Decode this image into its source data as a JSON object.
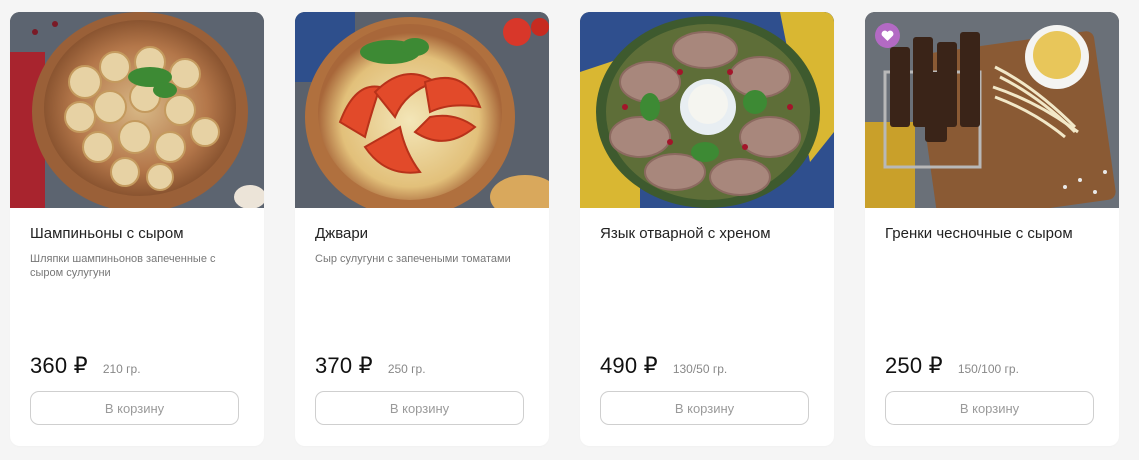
{
  "products": [
    {
      "title": "Шампиньоны с сыром",
      "description": "Шляпки шампиньонов запеченные с сыром сулугуни",
      "price": "360 ₽",
      "weight": "210 гр.",
      "cart_label": "В корзину",
      "image": "baked-mushrooms-clay-pot"
    },
    {
      "title": "Джвари",
      "description": "Сыр сулугуни с запечеными томатами",
      "price": "370 ₽",
      "weight": "250 гр.",
      "cart_label": "В корзину",
      "image": "cheese-tomato-clay-pot"
    },
    {
      "title": "Язык отварной с хреном",
      "description": "",
      "price": "490 ₽",
      "weight": "130/50 гр.",
      "cart_label": "В корзину",
      "image": "sliced-tongue-plate"
    },
    {
      "title": "Гренки чесночные с сыром",
      "description": "",
      "price": "250 ₽",
      "weight": "150/100 гр.",
      "cart_label": "В корзину",
      "image": "garlic-croutons-board",
      "badge": "heart-icon"
    }
  ],
  "colors": {
    "background": "#f5f5f5",
    "card": "#ffffff",
    "badge": "#b36ac4",
    "button_border": "#cfcfcf",
    "button_text": "#9a9a9a"
  }
}
